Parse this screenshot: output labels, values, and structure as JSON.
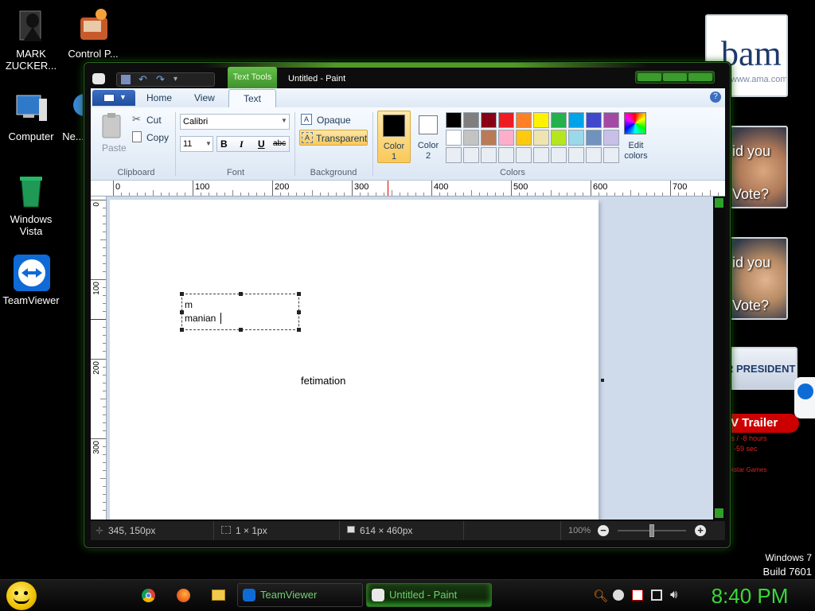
{
  "desktop": {
    "icons": [
      {
        "label": "MARK ZUCKER..."
      },
      {
        "label": "Control P..."
      },
      {
        "label": "Computer"
      },
      {
        "label": "Ne..."
      },
      {
        "label": "Windows Vista"
      },
      {
        "label": "TeamViewer"
      }
    ],
    "watermark": {
      "line1": "Windows 7",
      "line2": "Build 7601"
    },
    "ads": {
      "logo_text": "bam",
      "logo_sub": "www.ama.com",
      "vote1": {
        "line1": "id you",
        "line2": "Vote?"
      },
      "vote2": {
        "line1": "id you",
        "line2": "Vote?"
      },
      "president": "R PRESIDENT",
      "trailer": "V Trailer",
      "info1": "ys / -8 hours",
      "info2": "-59 sec",
      "info3": "ckstar Games"
    }
  },
  "window": {
    "title": "Untitled - Paint",
    "contextual_tab": "Text Tools",
    "tabs": [
      {
        "label": "Home"
      },
      {
        "label": "View"
      },
      {
        "label": "Text"
      }
    ],
    "clipboard": {
      "paste": "Paste",
      "cut": "Cut",
      "copy": "Copy",
      "group": "Clipboard"
    },
    "font": {
      "family": "Calibri",
      "size": "11",
      "bold": "B",
      "italic": "I",
      "underline": "U",
      "strike": "abc",
      "group": "Font"
    },
    "background": {
      "opaque": "Opaque",
      "transparent": "Transparent",
      "group": "Background"
    },
    "colors": {
      "color1_label": "Color",
      "color1_num": "1",
      "color2_label": "Color",
      "color2_num": "2",
      "edit_label": "Edit",
      "edit_label2": "colors",
      "group": "Colors",
      "color1": "#000000",
      "color2": "#ffffff",
      "palette_row1": [
        "#000000",
        "#7f7f7f",
        "#880015",
        "#ed1c24",
        "#ff7f27",
        "#fff200",
        "#22b14c",
        "#00a2e8",
        "#3f48cc",
        "#a349a4"
      ],
      "palette_row2": [
        "#ffffff",
        "#c3c3c3",
        "#b97a57",
        "#ffaec9",
        "#ffc90e",
        "#efe4b0",
        "#b5e61d",
        "#99d9ea",
        "#7092be",
        "#c8bfe7"
      ]
    },
    "ruler": {
      "h_ticks": [
        "0",
        "100",
        "200",
        "300",
        "400",
        "500",
        "600",
        "700"
      ],
      "v_ticks": [
        "0",
        "100",
        "200",
        "300"
      ]
    },
    "canvas": {
      "textbox_line1": "m",
      "textbox_line2": "manian",
      "text2": "fetimation"
    },
    "status": {
      "cursor": "345, 150px",
      "selection": "1 × 1px",
      "size": "614 × 460px",
      "zoom": "100%"
    }
  },
  "taskbar": {
    "buttons": [
      {
        "label": "TeamViewer"
      },
      {
        "label": "Untitled - Paint"
      }
    ],
    "clock": "8:40 PM"
  }
}
